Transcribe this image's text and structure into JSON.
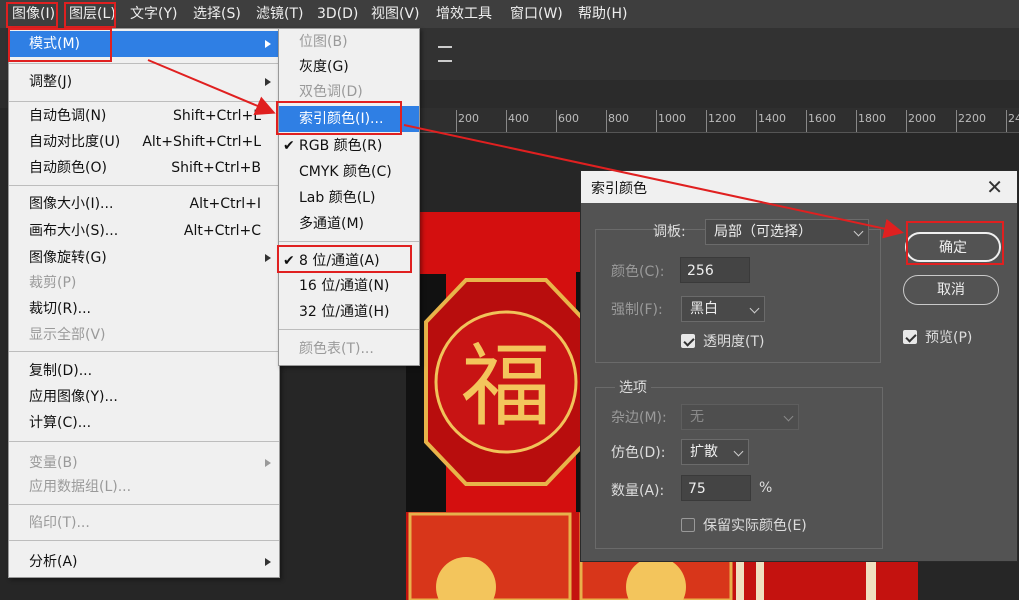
{
  "menubar": [
    "图像(I)",
    "图层(L)",
    "文字(Y)",
    "选择(S)",
    "滤镜(T)",
    "3D(D)",
    "视图(V)",
    "增效工具",
    "窗口(W)",
    "帮助(H)"
  ],
  "ruler_ticks": [
    "200",
    "400",
    "600",
    "800",
    "1000",
    "1200",
    "1400",
    "1600",
    "1800",
    "2000",
    "2200",
    "24"
  ],
  "image_menu": {
    "mode": "模式(M)",
    "adjust": "调整(J)",
    "auto_tone": {
      "label": "自动色调(N)",
      "shortcut": "Shift+Ctrl+L"
    },
    "auto_contrast": {
      "label": "自动对比度(U)",
      "shortcut": "Alt+Shift+Ctrl+L"
    },
    "auto_color": {
      "label": "自动颜色(O)",
      "shortcut": "Shift+Ctrl+B"
    },
    "image_size": {
      "label": "图像大小(I)...",
      "shortcut": "Alt+Ctrl+I"
    },
    "canvas_size": {
      "label": "画布大小(S)...",
      "shortcut": "Alt+Ctrl+C"
    },
    "rotation": "图像旋转(G)",
    "crop": "裁剪(P)",
    "trim": "裁切(R)...",
    "reveal_all": "显示全部(V)",
    "duplicate": "复制(D)...",
    "apply_image": "应用图像(Y)...",
    "calculations": "计算(C)...",
    "variables": "变量(B)",
    "apply_data_set": "应用数据组(L)...",
    "trap": "陷印(T)...",
    "analysis": "分析(A)"
  },
  "mode_menu": {
    "bitmap": "位图(B)",
    "grayscale": "灰度(G)",
    "duotone": "双色调(D)",
    "indexed": "索引颜色(I)...",
    "rgb": "RGB 颜色(R)",
    "cmyk": "CMYK 颜色(C)",
    "lab": "Lab 颜色(L)",
    "multichannel": "多通道(M)",
    "bit8": "8 位/通道(A)",
    "bit16": "16 位/通道(N)",
    "bit32": "32 位/通道(H)",
    "color_table": "颜色表(T)..."
  },
  "dialog": {
    "title": "索引颜色",
    "palette_label": "调板:",
    "palette_value": "局部（可选择）",
    "colors_label": "颜色(C):",
    "colors_value": "256",
    "forced_label": "强制(F):",
    "forced_value": "黑白",
    "transparency_label": "透明度(T)",
    "transparency_checked": true,
    "options_label": "选项",
    "matte_label": "杂边(M):",
    "matte_value": "无",
    "dither_label": "仿色(D):",
    "dither_value": "扩散",
    "amount_label": "数量(A):",
    "amount_value": "75",
    "amount_unit": "%",
    "preserve_label": "保留实际颜色(E)",
    "preserve_checked": false,
    "ok": "确定",
    "cancel": "取消",
    "preview_label": "预览(P)",
    "preview_checked": true
  },
  "colors": {
    "highlight": "#2f7fe4",
    "annotation": "#e02020",
    "canvas": "#d40f0f"
  }
}
